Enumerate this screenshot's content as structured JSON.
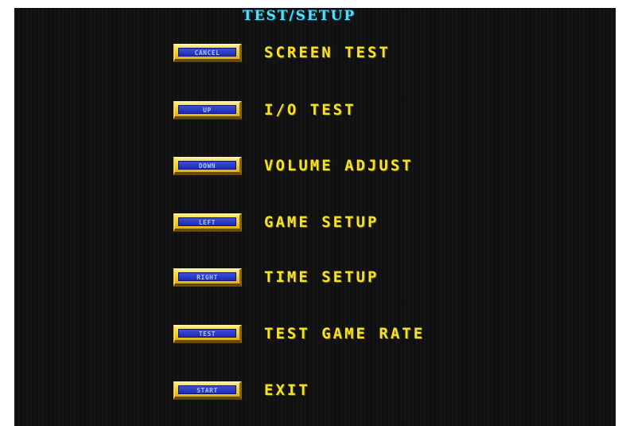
{
  "screen": {
    "title": "TEST/SETUP"
  },
  "menu": {
    "items": [
      {
        "button": "CANCEL",
        "label": "SCREEN TEST"
      },
      {
        "button": "UP",
        "label": "I/O TEST"
      },
      {
        "button": "DOWN",
        "label": "VOLUME ADJUST"
      },
      {
        "button": "LEFT",
        "label": "GAME SETUP"
      },
      {
        "button": "RIGHT",
        "label": "TIME SETUP"
      },
      {
        "button": "TEST",
        "label": "TEST GAME RATE"
      },
      {
        "button": "START",
        "label": "EXIT"
      }
    ]
  },
  "colors": {
    "background": "#101010",
    "title": "#4fe0ff",
    "label": "#f4e22a",
    "button_frame": "#e8c020",
    "button_face": "#2a36c8"
  }
}
